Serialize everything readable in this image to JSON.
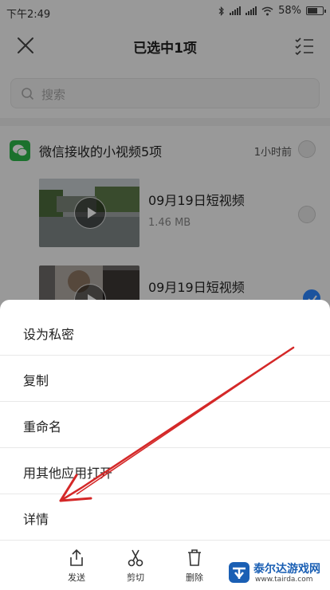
{
  "status_bar": {
    "time": "下午2:49",
    "battery": "58%",
    "battery_level": 0.58
  },
  "header": {
    "title": "已选中1项",
    "close_icon": "close-icon",
    "select_all_icon": "checklist-icon"
  },
  "search": {
    "placeholder": "搜索"
  },
  "group": {
    "title": "微信接收的小视频5项",
    "time": "1小时前"
  },
  "files": [
    {
      "name": "09月19日短视频",
      "size": "1.46 MB",
      "selected": false
    },
    {
      "name": "09月19日短视频",
      "size": "",
      "selected": true
    }
  ],
  "sheet_menu": [
    {
      "label": "设为私密"
    },
    {
      "label": "复制"
    },
    {
      "label": "重命名"
    },
    {
      "label": "用其他应用打开"
    },
    {
      "label": "详情"
    }
  ],
  "toolbar": {
    "send": "发送",
    "cut": "剪切",
    "delete": "删除"
  },
  "watermark": {
    "name": "泰尔达游戏网",
    "url": "www.tairda.com"
  },
  "colors": {
    "accent": "#2d86ff",
    "wechat": "#2db64a",
    "arrow": "#d42828"
  }
}
